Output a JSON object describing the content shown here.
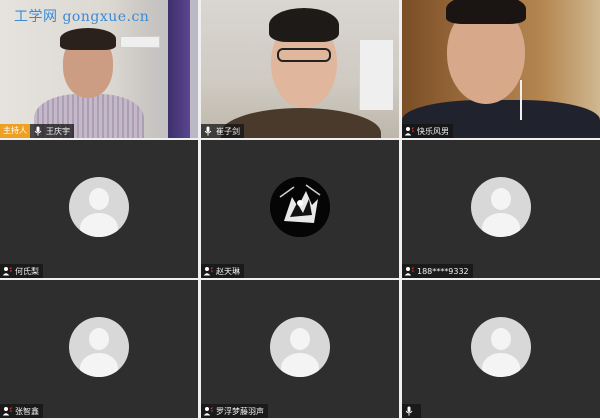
{
  "watermark": "工学网 gongxue.cn",
  "host_badge": "主持人",
  "participants": [
    {
      "name": "王庆宇",
      "video": true
    },
    {
      "name": "崔子剑",
      "video": true
    },
    {
      "name": "快乐风男",
      "video": true
    },
    {
      "name": "何氏梨",
      "video": false
    },
    {
      "name": "赵天琳",
      "video": false,
      "avatar": "art"
    },
    {
      "name": "188****9332",
      "video": false
    },
    {
      "name": "张智鑫",
      "video": false
    },
    {
      "name": "罗浮梦藤羽声",
      "video": false
    },
    {
      "name": "",
      "video": false
    }
  ],
  "colors": {
    "tile_bg": "#2e2e2e",
    "host_badge": "#f0a020",
    "watermark": "#3a8ad6"
  }
}
